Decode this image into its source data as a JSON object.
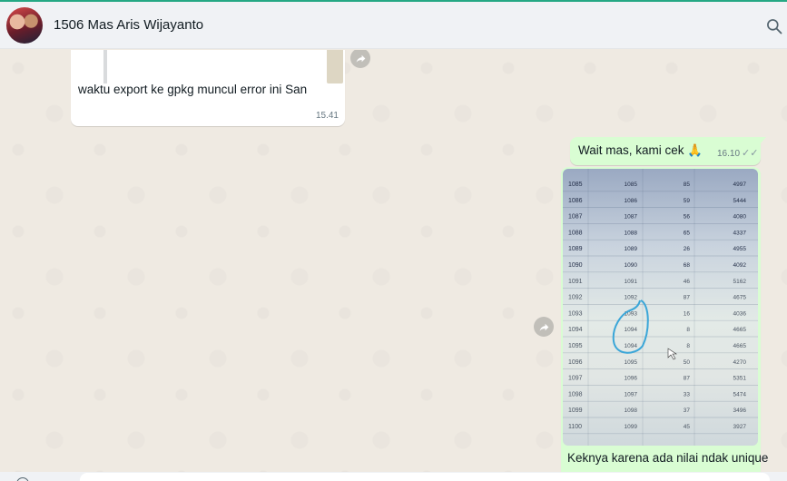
{
  "header": {
    "contact_name": "1506 Mas Aris Wijayanto",
    "avatar_icon": "contact-avatar",
    "search_icon": "search-icon"
  },
  "messages": [
    {
      "direction": "incoming",
      "text": "waktu export ke gpkg muncul error ini San",
      "time": "15.41",
      "has_image_preview": true
    },
    {
      "direction": "outgoing",
      "text": "Wait mas, kami cek 🙏",
      "time": "16.10",
      "status": "✓✓"
    },
    {
      "direction": "outgoing",
      "type": "image",
      "caption": "Keknya karena ada nilai ndak unique",
      "photo_table": [
        [
          "1085",
          "1085",
          "85",
          "4997"
        ],
        [
          "1086",
          "1086",
          "59",
          "5444"
        ],
        [
          "1087",
          "1087",
          "56",
          "4080"
        ],
        [
          "1088",
          "1088",
          "65",
          "4337"
        ],
        [
          "1089",
          "1089",
          "26",
          "4955"
        ],
        [
          "1090",
          "1090",
          "68",
          "4092"
        ],
        [
          "1091",
          "1091",
          "46",
          "5162"
        ],
        [
          "1092",
          "1092",
          "87",
          "4675"
        ],
        [
          "1093",
          "1093",
          "16",
          "4036"
        ],
        [
          "1094",
          "1094",
          "8",
          "4665"
        ],
        [
          "1095",
          "1094",
          "8",
          "4665"
        ],
        [
          "1096",
          "1095",
          "50",
          "4270"
        ],
        [
          "1097",
          "1096",
          "87",
          "5351"
        ],
        [
          "1098",
          "1097",
          "33",
          "5474"
        ],
        [
          "1099",
          "1098",
          "37",
          "3496"
        ],
        [
          "1100",
          "1099",
          "45",
          "3927"
        ]
      ]
    }
  ],
  "colors": {
    "incoming_bubble": "#ffffff",
    "outgoing_bubble": "#d9fdd3",
    "chat_background": "#efeae2",
    "header_background": "#f0f2f5",
    "highlight_circle": "#3aa6d8"
  }
}
